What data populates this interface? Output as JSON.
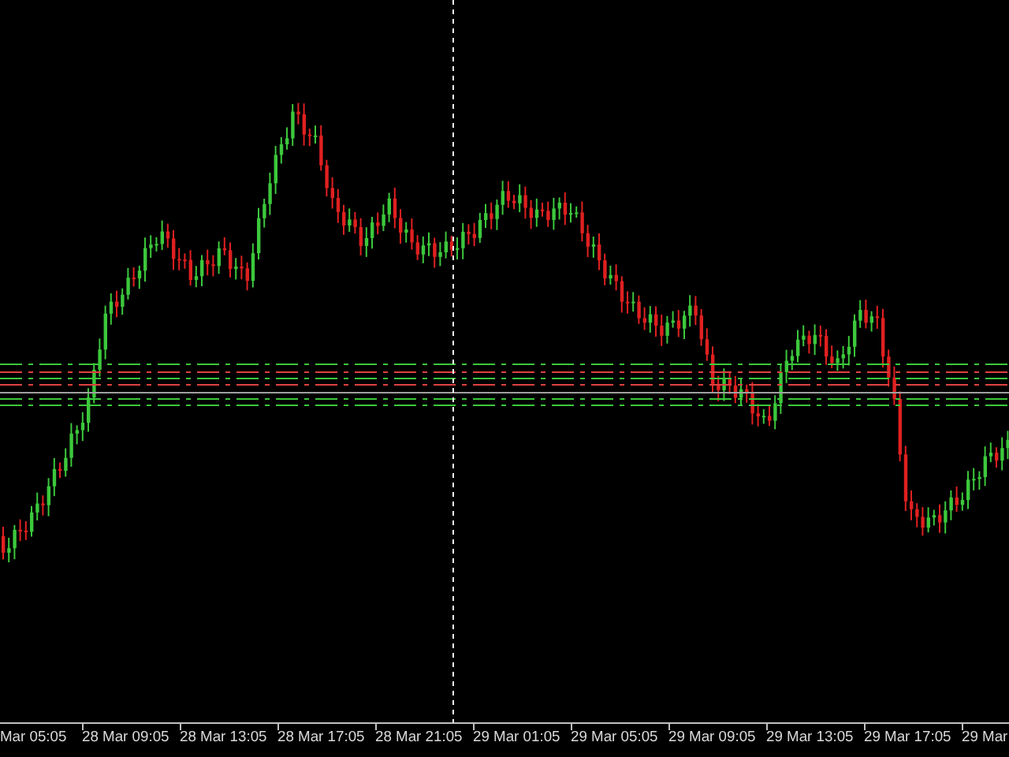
{
  "chart": {
    "time_axis": {
      "labels": [
        "Mar 05:05",
        "28 Mar 09:05",
        "28 Mar 13:05",
        "28 Mar 17:05",
        "28 Mar 21:05",
        "29 Mar 01:05",
        "29 Mar 05:05",
        "29 Mar 09:05",
        "29 Mar 13:05",
        "29 Mar 17:05",
        "29 Mar"
      ]
    }
  }
}
